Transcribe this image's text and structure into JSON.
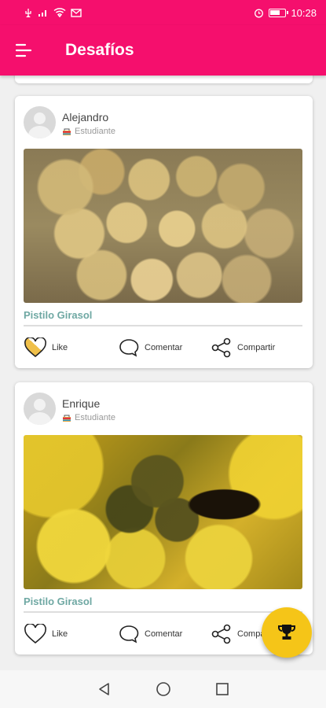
{
  "status_bar": {
    "time": "10:28",
    "icons": [
      "usb-icon",
      "signal-icon",
      "wifi-icon",
      "mail-icon",
      "alarm-icon",
      "battery-icon"
    ]
  },
  "app_bar": {
    "title": "Desafíos",
    "menu_icon": "menu-icon",
    "color": "#f50f6d"
  },
  "posts": [
    {
      "user_name": "Alejandro",
      "user_role": "Estudiante",
      "caption": "Pistilo Girasol",
      "liked": true,
      "actions": {
        "like": "Like",
        "comment": "Comentar",
        "share": "Compartir"
      }
    },
    {
      "user_name": "Enrique",
      "user_role": "Estudiante",
      "caption": "Pistilo Girasol",
      "liked": false,
      "actions": {
        "like": "Like",
        "comment": "Comentar",
        "share": "Compartir"
      }
    }
  ],
  "fab": {
    "icon": "trophy-icon",
    "color": "#f5c518"
  },
  "nav_bar": {
    "icons": [
      "back-icon",
      "home-icon",
      "recents-icon"
    ]
  },
  "colors": {
    "accent": "#f50f6d",
    "caption": "#6fa8a3",
    "like_fill": "#f0c04a"
  }
}
